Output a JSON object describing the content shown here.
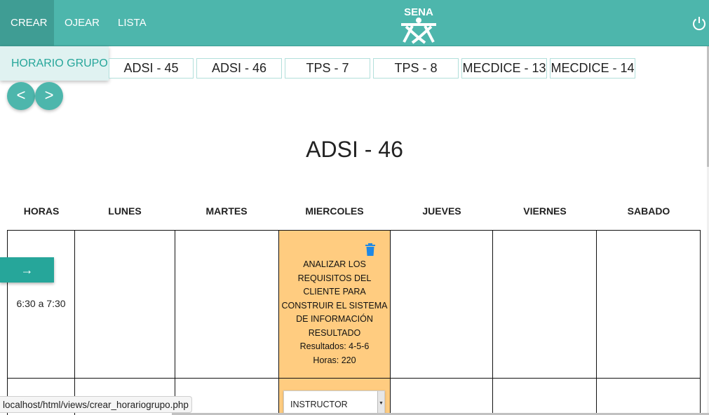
{
  "nav": {
    "items": [
      {
        "label": "CREAR",
        "active": true
      },
      {
        "label": "OJEAR",
        "active": false
      },
      {
        "label": "LISTA",
        "active": false
      }
    ],
    "logo_text": "SENA",
    "power_icon": "power-icon",
    "accent_color": "#4db6ac"
  },
  "dropdown": {
    "items": [
      "HORARIO GRUPO"
    ]
  },
  "group_tabs": [
    "ADSI - 45",
    "ADSI - 46",
    "TPS - 7",
    "TPS - 8",
    "MECDICE - 13",
    "MECDICE - 14"
  ],
  "pager": {
    "prev_label": "<",
    "next_label": ">"
  },
  "schedule": {
    "title": "ADSI - 46",
    "columns": [
      "HORAS",
      "LUNES",
      "MARTES",
      "MIERCOLES",
      "JUEVES",
      "VIERNES",
      "SABADO"
    ],
    "rows": [
      {
        "hour": "6:30 a 7:30",
        "arrow_label": "→",
        "miercoles": {
          "competencia": "ANALIZAR LOS REQUISITOS DEL CLIENTE PARA CONSTRUIR EL SISTEMA DE INFORMACIÓN RESULTADO",
          "resultados": "Resultados: 4-5-6",
          "horas": "Horas: 220",
          "highlight_color": "#ffcc80"
        }
      },
      {
        "hour": "",
        "miercoles": {
          "select_value": "INSTRUCTOR"
        }
      }
    ]
  },
  "status_bar": {
    "url": "localhost/html/views/crear_horariogrupo.php"
  }
}
